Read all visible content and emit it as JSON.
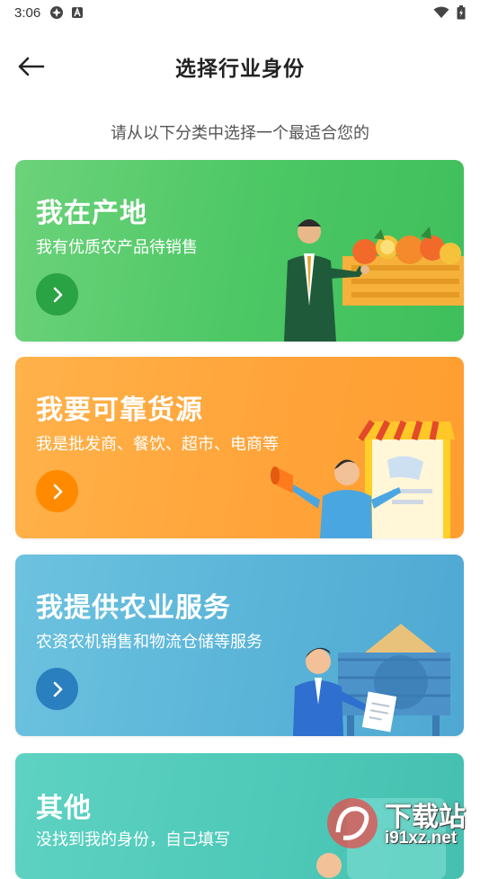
{
  "status_bar": {
    "time": "3:06"
  },
  "header": {
    "title": "选择行业身份"
  },
  "subtitle": "请从以下分类中选择一个最适合您的",
  "cards": [
    {
      "title": "我在产地",
      "desc": "我有优质农产品待销售",
      "accent": "#2aa344"
    },
    {
      "title": "我要可靠货源",
      "desc": "我是批发商、餐饮、超市、电商等",
      "accent": "#ff8a00"
    },
    {
      "title": "我提供农业服务",
      "desc": "农资农机销售和物流仓储等服务",
      "accent": "#2a7fbf"
    },
    {
      "title": "其他",
      "desc": "没找到我的身份，自己填写",
      "accent": "#2fb3a0"
    }
  ],
  "watermark": {
    "top": "下载站",
    "bottom": "i91xz.net"
  },
  "icons": {
    "back": "arrow-left-icon",
    "chevron": "chevron-right-icon"
  }
}
